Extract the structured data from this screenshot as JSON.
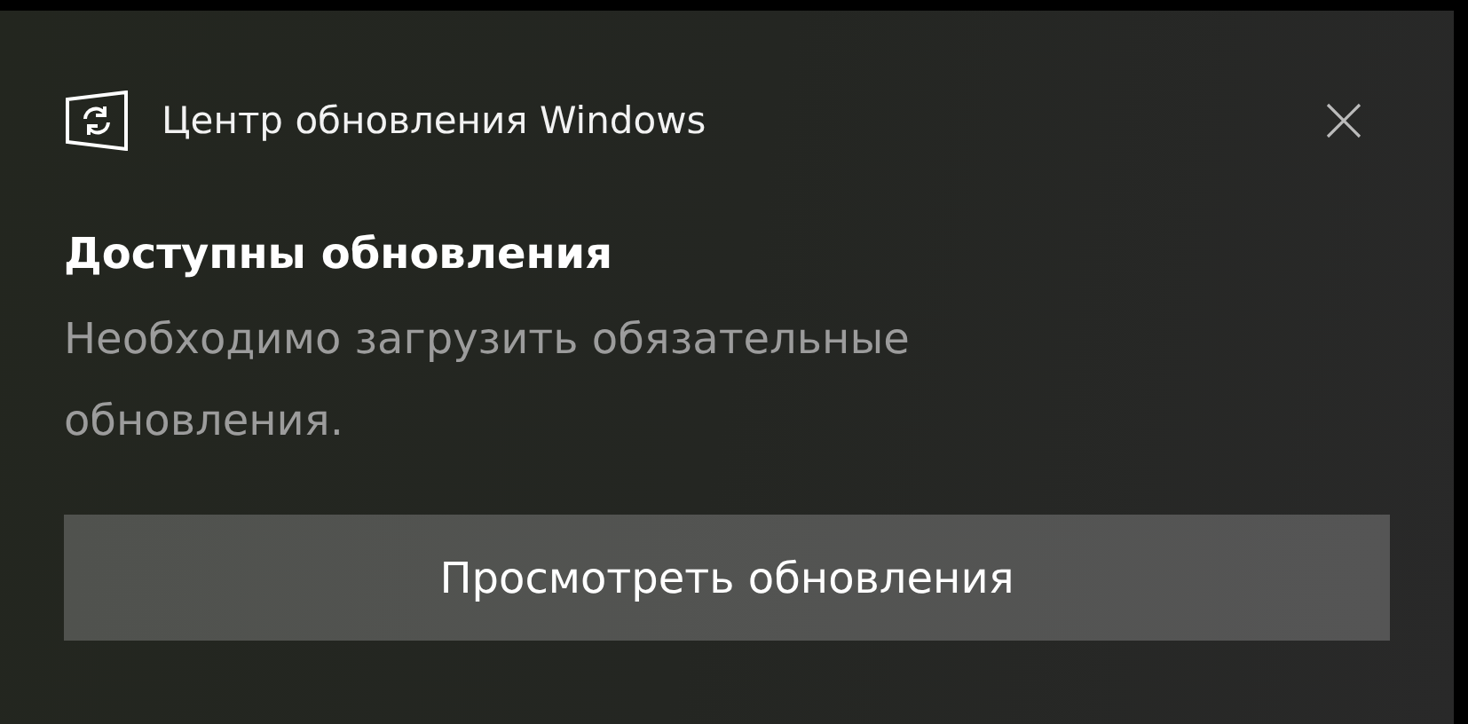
{
  "app": {
    "title": "Центр обновления Windows"
  },
  "notification": {
    "title": "Доступны обновления",
    "body": "Необходимо загрузить обязательные обновления."
  },
  "buttons": [
    "Просмотреть обновления"
  ]
}
